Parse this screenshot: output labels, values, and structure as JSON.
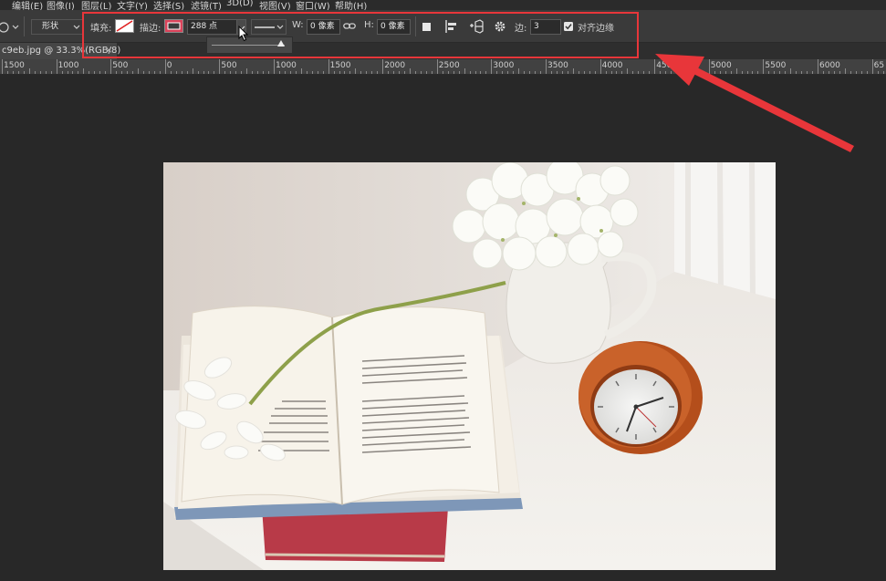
{
  "menu": [
    "编辑(E)",
    "图像(I)",
    "图层(L)",
    "文字(Y)",
    "选择(S)",
    "滤镜(T)",
    "3D(D)",
    "视图(V)",
    "窗口(W)",
    "帮助(H)"
  ],
  "options": {
    "mode_value": "形状",
    "fill_label": "填充:",
    "stroke_label": "描边:",
    "stroke_width": "288 点",
    "w_label": "W:",
    "w_value": "0 像素",
    "h_label": "H:",
    "h_value": "0 像素",
    "sides_label": "边:",
    "sides_value": "3",
    "align_edges_label": "对齐边缘",
    "align_edges_checked": true,
    "stroke_width_slider_fraction": 0.95
  },
  "document_tab": {
    "title": "c9eb.jpg @ 33.3%(RGB/8)",
    "close": "×"
  },
  "ruler_labels": [
    "1500",
    "1000",
    "500",
    "0",
    "500",
    "1000",
    "1500",
    "2000",
    "2500",
    "3000",
    "3500",
    "4000",
    "4500",
    "5000",
    "5500",
    "6000",
    "65"
  ],
  "colors": {
    "highlight": "#e8363a",
    "stroke_swatch": "#d9435a",
    "clock_orange": "#c2561f",
    "book_red": "#b83a48"
  },
  "icons": [
    "chevron-down-icon",
    "no-fill-swatch-icon",
    "stroke-swatch-icon",
    "link-icon",
    "path-ops-icon",
    "path-align-icon",
    "path-arrange-icon",
    "gear-icon",
    "checkbox-icon",
    "cursor-icon",
    "annotation-arrow-icon"
  ]
}
